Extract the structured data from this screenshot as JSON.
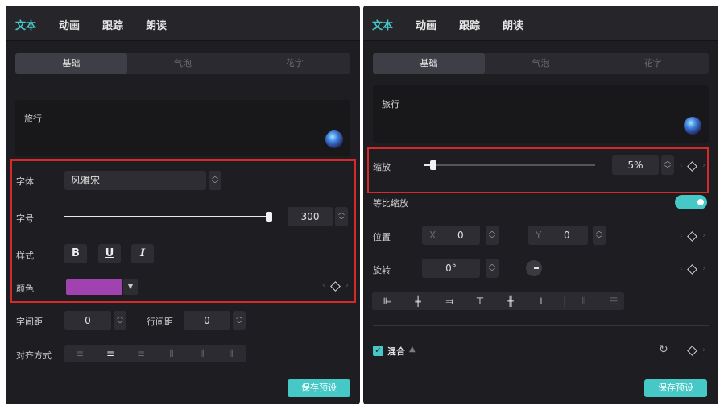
{
  "left": {
    "tabs": [
      "文本",
      "动画",
      "跟踪",
      "朗读"
    ],
    "subtabs": [
      "基础",
      "气泡",
      "花字"
    ],
    "text_content": "旅行",
    "font": {
      "label": "字体",
      "value": "风雅宋"
    },
    "size": {
      "label": "字号",
      "value": "300",
      "level": 1.0
    },
    "style": {
      "label": "样式",
      "bold": "B",
      "underline": "U",
      "italic": "I"
    },
    "color": {
      "label": "颜色",
      "value": "#a043b0"
    },
    "char_spacing": {
      "label": "字间距",
      "value": "0"
    },
    "line_spacing": {
      "label": "行间距",
      "value": "0"
    },
    "alignment": {
      "label": "对齐方式"
    },
    "save_label": "保存预设"
  },
  "right": {
    "tabs": [
      "文本",
      "动画",
      "跟踪",
      "朗读"
    ],
    "subtabs": [
      "基础",
      "气泡",
      "花字"
    ],
    "text_content": "旅行",
    "scale": {
      "label": "缩放",
      "value": "5%",
      "level": 0.05
    },
    "uniform_scale": {
      "label": "等比缩放",
      "on": true
    },
    "position": {
      "label": "位置",
      "x_label": "X",
      "x_value": "0",
      "y_label": "Y",
      "y_value": "0"
    },
    "rotation": {
      "label": "旋转",
      "value": "0°"
    },
    "blend": {
      "label": "混合"
    },
    "save_label": "保存预设"
  },
  "colors": {
    "accent": "#45c8c6",
    "highlight": "#d42a2a",
    "panel": "#1e1e22"
  }
}
